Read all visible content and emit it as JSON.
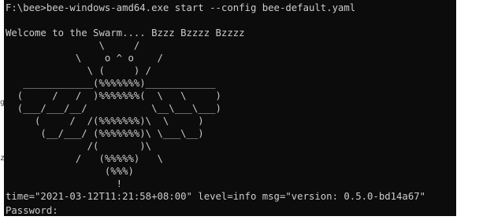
{
  "terminal": {
    "lines": [
      "F:\\bee>bee-windows-amd64.exe start --config bee-default.yaml",
      "",
      "Welcome to the Swarm.... Bzzz Bzzzz Bzzzz",
      "                \\     /",
      "            \\    o ^ o    /",
      "              \\ (     ) /",
      "   ____________(%%%%%%%)____________",
      "  (     /   /  )%%%%%%%(  \\   \\     )",
      "  (___/___/__/           \\__\\___\\___)",
      "     (     /  /(%%%%%%%)\\  \\     )",
      "      (__/___/ (%%%%%%%)\\ \\___\\__)",
      "              /(       )\\",
      "            /   (%%%%%)   \\",
      "                 (%%%)",
      "                   !",
      "time=\"2021-03-12T11:21:58+08:00\" level=info msg=\"version: 0.5.0-bd14a67\"",
      "Password: "
    ]
  },
  "left_strip_fragments": [
    "g",
    "z"
  ],
  "colors": {
    "terminal_background": "#0c0c0c",
    "terminal_text": "#cccccc"
  }
}
